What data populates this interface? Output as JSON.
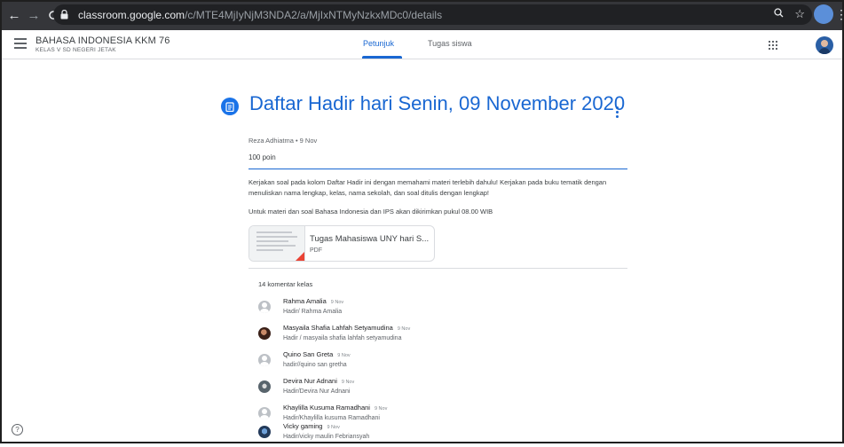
{
  "browser": {
    "url_host": "classroom.google.com",
    "url_path": "/c/MTE4MjIyNjM3NDA2/a/MjIxNTMyNzkxMDc0/details"
  },
  "header": {
    "class_title": "BAHASA INDONESIA KKM 76",
    "class_subtitle": "KELAS V SD NEGERI JETAK",
    "tabs": [
      {
        "label": "Petunjuk",
        "active": true
      },
      {
        "label": "Tugas siswa",
        "active": false
      }
    ]
  },
  "assignment": {
    "title": "Daftar Hadir hari Senin, 09 November 2020",
    "meta": "Reza Adhiatma • 9 Nov",
    "points": "100 poin",
    "description": "Kerjakan soal pada kolom Daftar Hadir ini dengan memahami materi terlebih dahulu! Kerjakan pada buku tematik dengan menuliskan nama lengkap, kelas, nama sekolah, dan soal ditulis dengan lengkap!",
    "description2": "Untuk materi dan soal Bahasa Indonesia dan IPS akan dikirimkan pukul 08.00 WIB",
    "attachment": {
      "name": "Tugas Mahasiswa UNY hari S...",
      "type": "PDF"
    }
  },
  "comments": {
    "header": "14 komentar kelas",
    "items": [
      {
        "name": "Rahma Amalia",
        "date": "9 Nov",
        "text": "Hadir/ Rahma Amalia",
        "avatar": "default"
      },
      {
        "name": "Masyaila Shafia Lahfah Setyamudina",
        "date": "9 Nov",
        "text": "Hadir / masyaila shafia lahfah setyamudina",
        "avatar": "photo1"
      },
      {
        "name": "Quino San Greta",
        "date": "9 Nov",
        "text": "hadir//quino san gretha",
        "avatar": "default"
      },
      {
        "name": "Devira Nur Adnani",
        "date": "9 Nov",
        "text": "Hadir/Devira Nur Adnani",
        "avatar": "photo2"
      },
      {
        "name": "Khaylilla Kusuma Ramadhani",
        "date": "9 Nov",
        "text": "Hadir/Khaylilla kusuma Ramadhani",
        "avatar": "default"
      },
      {
        "name": "Vicky gaming",
        "date": "9 Nov",
        "text": "Hadir/vicky maulin Febriansyah",
        "avatar": "photo3"
      }
    ]
  },
  "icons": {
    "back": "arrow-left-icon",
    "forward": "arrow-right-icon",
    "reload": "reload-icon",
    "lock": "lock-icon",
    "zoom": "zoom-icon",
    "star": "star-icon",
    "menu": "hamburger-icon",
    "apps": "apps-grid-icon",
    "assignment": "assignment-icon",
    "more": "more-vert-icon",
    "help": "help-icon"
  },
  "colors": {
    "accent": "#1967d2",
    "browser_bar": "#35363a",
    "omnibox": "#202124"
  }
}
